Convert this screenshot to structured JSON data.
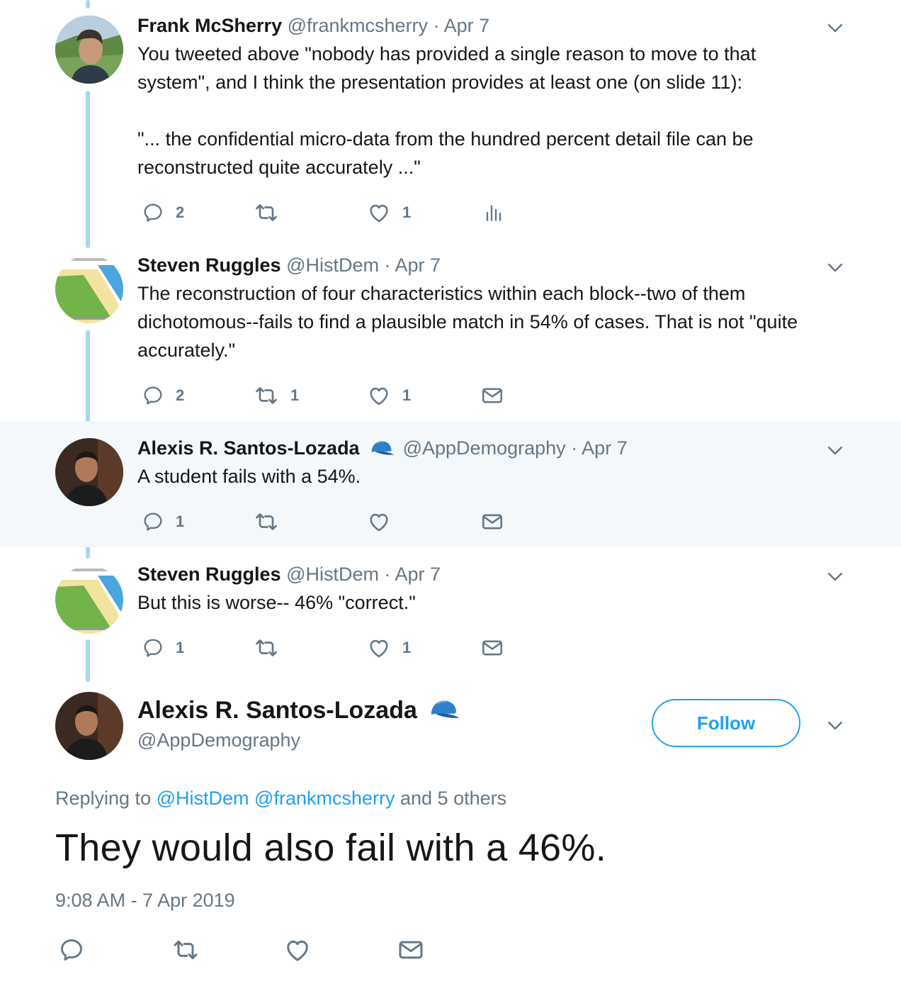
{
  "tweets": [
    {
      "name": "Frank McSherry",
      "handle": "@frankmcsherry",
      "date": "Apr 7",
      "text": [
        "You tweeted above \"nobody has provided a single reason to move to that",
        "system\", and I think the presentation provides at least one (on slide 11):",
        "",
        "\"... the confidential micro-data from the hundred percent detail file can be",
        "reconstructed quite accurately ...\""
      ],
      "replies": "2",
      "retweets": "",
      "likes": "1",
      "last_action_icon": "analytics-icon"
    },
    {
      "name": "Steven Ruggles",
      "handle": "@HistDem",
      "date": "Apr 7",
      "text": [
        "The reconstruction of four characteristics within each block--two of them",
        "dichotomous--fails to find a plausible match in 54% of cases. That is not \"quite",
        "accurately.\""
      ],
      "replies": "2",
      "retweets": "1",
      "likes": "1",
      "last_action_icon": "mail-icon"
    },
    {
      "name": "Alexis R. Santos-Lozada",
      "handle": "@AppDemography",
      "date": "Apr 7",
      "text": [
        "A student fails with a 54%."
      ],
      "replies": "1",
      "retweets": "",
      "likes": "",
      "last_action_icon": "mail-icon"
    },
    {
      "name": "Steven Ruggles",
      "handle": "@HistDem",
      "date": "Apr 7",
      "text": [
        "But this is worse-- 46% \"correct.\""
      ],
      "replies": "1",
      "retweets": "",
      "likes": "1",
      "last_action_icon": "mail-icon"
    }
  ],
  "separator": "·",
  "main_tweet": {
    "name": "Alexis R. Santos-Lozada",
    "handle": "@AppDemography",
    "follow_label": "Follow",
    "replying_prefix": "Replying to",
    "reply_mention_1": "@HistDem",
    "reply_mention_2": "@frankmcsherry",
    "replying_suffix": "and 5 others",
    "text": "They would also fail with a 46%.",
    "timestamp": "9:08 AM - 7 Apr 2019"
  },
  "colors": {
    "accent": "#1da1f2",
    "thread_line": "#a7d6f2",
    "muted": "#657786",
    "highlight_bg": "#f5f8fa"
  }
}
